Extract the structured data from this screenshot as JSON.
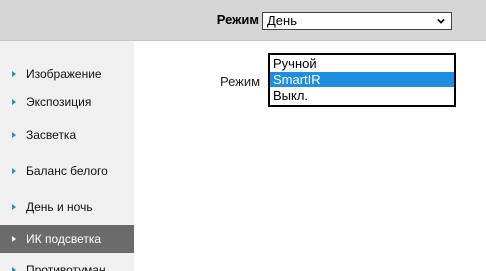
{
  "header": {
    "mode_label": "Режим",
    "mode_value": "День"
  },
  "sidebar": {
    "items": [
      {
        "label": "Изображение"
      },
      {
        "label": "Экспозиция"
      },
      {
        "label": "Засветка"
      },
      {
        "label": "Баланс белого"
      },
      {
        "label": "День и ночь"
      },
      {
        "label": "ИК подсветка"
      },
      {
        "label": "Противотуман"
      }
    ],
    "active_index": 5
  },
  "main": {
    "mode_label": "Режим",
    "dropdown_options": [
      "Ручной",
      "SmartIR",
      "Выкл."
    ],
    "selected_option": "SmartIR"
  },
  "colors": {
    "accent": "#1e8fe0",
    "active_item_bg": "#6b6b6b",
    "topbar_bg": "#d6d6d6"
  },
  "icons": {
    "sidebar_bullet": "triangle-right-icon",
    "select_arrow": "chevron-down-icon"
  }
}
